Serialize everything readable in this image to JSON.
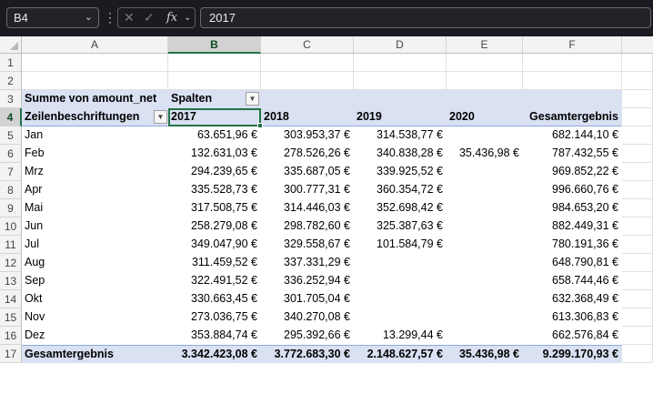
{
  "formula_bar": {
    "name_box": "B4",
    "fx_symbol": "fx",
    "formula_value": "2017"
  },
  "columns": [
    "A",
    "B",
    "C",
    "D",
    "E",
    "F"
  ],
  "rows": [
    "1",
    "2",
    "3",
    "4",
    "5",
    "6",
    "7",
    "8",
    "9",
    "10",
    "11",
    "12",
    "13",
    "14",
    "15",
    "16",
    "17"
  ],
  "pivot": {
    "value_label": "Summe von amount_net",
    "columns_label": "Spalten",
    "row_labels_header": "Zeilenbeschriftungen",
    "years": [
      "2017",
      "2018",
      "2019",
      "2020"
    ],
    "grand_total_label": "Gesamtergebnis",
    "rows": [
      {
        "label": "Jan",
        "values": [
          "63.651,96 €",
          "303.953,37 €",
          "314.538,77 €",
          "",
          "682.144,10 €"
        ]
      },
      {
        "label": "Feb",
        "values": [
          "132.631,03 €",
          "278.526,26 €",
          "340.838,28 €",
          "35.436,98 €",
          "787.432,55 €"
        ]
      },
      {
        "label": "Mrz",
        "values": [
          "294.239,65 €",
          "335.687,05 €",
          "339.925,52 €",
          "",
          "969.852,22 €"
        ]
      },
      {
        "label": "Apr",
        "values": [
          "335.528,73 €",
          "300.777,31 €",
          "360.354,72 €",
          "",
          "996.660,76 €"
        ]
      },
      {
        "label": "Mai",
        "values": [
          "317.508,75 €",
          "314.446,03 €",
          "352.698,42 €",
          "",
          "984.653,20 €"
        ]
      },
      {
        "label": "Jun",
        "values": [
          "258.279,08 €",
          "298.782,60 €",
          "325.387,63 €",
          "",
          "882.449,31 €"
        ]
      },
      {
        "label": "Jul",
        "values": [
          "349.047,90 €",
          "329.558,67 €",
          "101.584,79 €",
          "",
          "780.191,36 €"
        ]
      },
      {
        "label": "Aug",
        "values": [
          "311.459,52 €",
          "337.331,29 €",
          "",
          "",
          "648.790,81 €"
        ]
      },
      {
        "label": "Sep",
        "values": [
          "322.491,52 €",
          "336.252,94 €",
          "",
          "",
          "658.744,46 €"
        ]
      },
      {
        "label": "Okt",
        "values": [
          "330.663,45 €",
          "301.705,04 €",
          "",
          "",
          "632.368,49 €"
        ]
      },
      {
        "label": "Nov",
        "values": [
          "273.036,75 €",
          "340.270,08 €",
          "",
          "",
          "613.306,83 €"
        ]
      },
      {
        "label": "Dez",
        "values": [
          "353.884,74 €",
          "295.392,66 €",
          "13.299,44 €",
          "",
          "662.576,84 €"
        ]
      }
    ],
    "totals": [
      "3.342.423,08 €",
      "3.772.683,30 €",
      "2.148.627,57 €",
      "35.436,98 €",
      "9.299.170,93 €"
    ]
  },
  "selected_cell": "B4"
}
